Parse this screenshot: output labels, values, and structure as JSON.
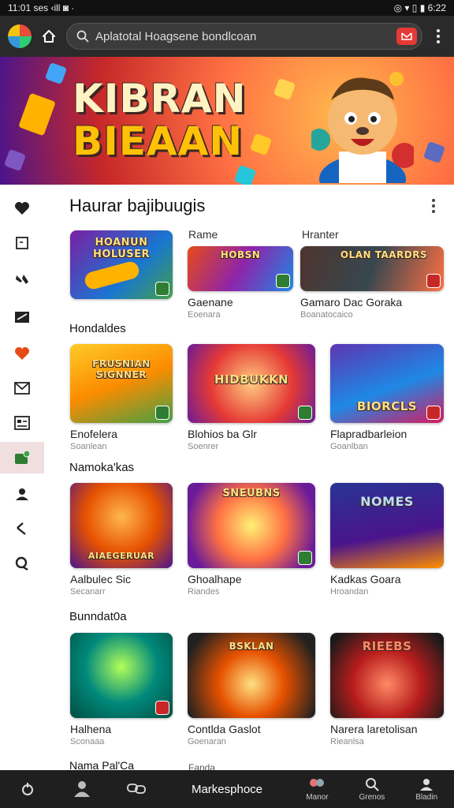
{
  "statusbar": {
    "left": "11:01 ses ‹ill ◙ ·",
    "right": "◎ ▾ ▯ ▮ 6:22"
  },
  "search": {
    "value": "Aplatotal Hoagsene bondlcoan"
  },
  "hero": {
    "title_line1": "KIBRAN",
    "title_line2": "BIEAAN"
  },
  "main": {
    "title": "Haurar bajibuugis",
    "col_head_1": "Rame",
    "col_head_2": "Hranter",
    "featured": [
      {
        "thumb_text": "HOANUN HOLUSER"
      },
      {
        "thumb_text": "HOBSN",
        "title": "Gaenane",
        "sub": "Eoenara"
      },
      {
        "thumb_text": "OLAN TAARDRS",
        "title": "Gamaro Dac Goraka",
        "sub": "Boanatocaico"
      }
    ],
    "sections": [
      {
        "title": "Hondaldes",
        "cards": [
          {
            "thumb_text": "FRUSNIAN SIGNNER",
            "title": "Enofelera",
            "sub": "Soanlean"
          },
          {
            "thumb_text": "HIDBUKKN",
            "title": "Blohios ba Glr",
            "sub": "Soenrer"
          },
          {
            "thumb_text": "BIORCLS",
            "title": "Flapradbarleion",
            "sub": "Goanlban"
          }
        ]
      },
      {
        "title": "Namoka'kas",
        "cards": [
          {
            "thumb_text": "AIAEGERUAR",
            "title": "Aalbulec Sic",
            "sub": "Secanarr"
          },
          {
            "thumb_text": "SNEUBNS",
            "title": "Ghoalhape",
            "sub": "Riandes"
          },
          {
            "thumb_text": "NOMES",
            "title": "Kadkas Goara",
            "sub": "Hroandan"
          }
        ]
      },
      {
        "title": "Bunndat0a",
        "cards": [
          {
            "thumb_text": "",
            "title": "Halhena",
            "sub": "Sconaaa"
          },
          {
            "thumb_text": "BSKLAN",
            "title": "Contlda Gaslot",
            "sub": "Goenaran"
          },
          {
            "thumb_text": "RIEEBS",
            "title": "Narera laretolisan",
            "sub": "Rieanlsa"
          }
        ]
      },
      {
        "title": "Nama Pal'Ca",
        "cards": [
          {
            "title": "Fanda"
          }
        ]
      }
    ]
  },
  "bottomnav": {
    "marketplace": "Markesphoce",
    "manor": "Manor",
    "grenos": "Grenos",
    "bladin": "Bladin"
  },
  "colors": {
    "accent_red": "#e53935",
    "toolbar": "#2a2a2a",
    "nav": "#1f1f1f"
  }
}
